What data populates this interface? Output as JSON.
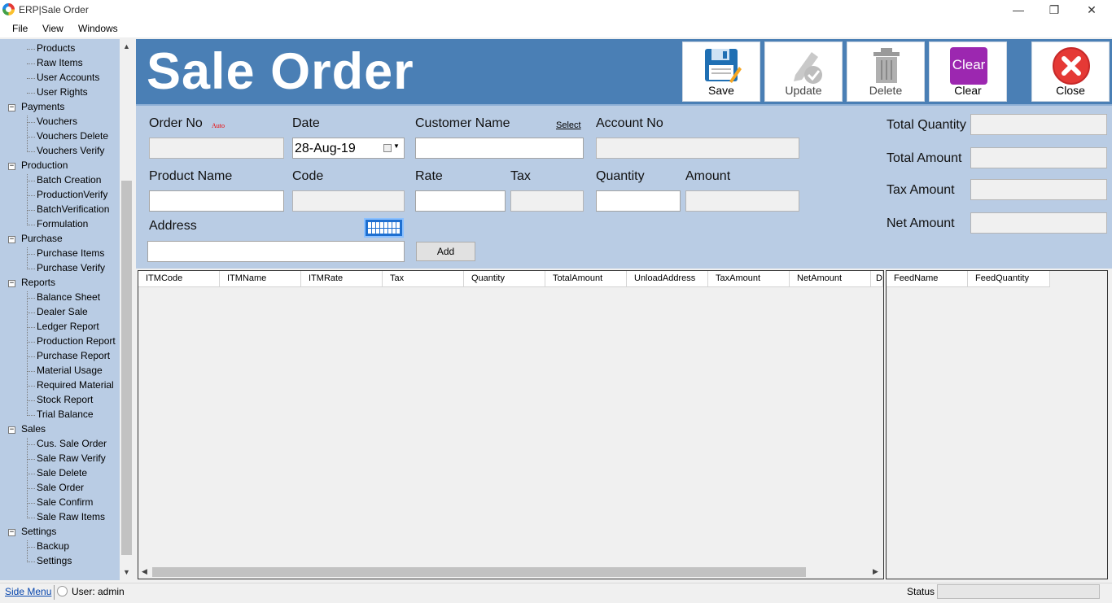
{
  "window": {
    "title": "ERP|Sale Order",
    "minimize": "—",
    "restore": "❐",
    "close": "✕"
  },
  "menu": [
    "File",
    "View",
    "Windows"
  ],
  "sidebar": {
    "leaves_top": [
      "Products",
      "Raw Items",
      "User Accounts",
      "User Rights"
    ],
    "groups": [
      {
        "label": "Payments",
        "items": [
          "Vouchers",
          "Vouchers Delete",
          "Vouchers Verify"
        ]
      },
      {
        "label": "Production",
        "items": [
          "Batch Creation",
          "ProductionVerify",
          "BatchVerification",
          "Formulation"
        ]
      },
      {
        "label": "Purchase",
        "items": [
          "Purchase Items",
          "Purchase Verify"
        ]
      },
      {
        "label": "Reports",
        "items": [
          "Balance Sheet",
          "Dealer Sale",
          "Ledger Report",
          "Production Report",
          "Purchase Report",
          "Material Usage",
          "Required Material",
          "Stock Report",
          "Trial Balance"
        ]
      },
      {
        "label": "Sales",
        "items": [
          "Cus. Sale Order",
          "Sale Raw Verify",
          "Sale Delete",
          "Sale Order",
          "Sale Confirm",
          "Sale Raw Items"
        ]
      },
      {
        "label": "Settings",
        "items": [
          "Backup",
          "Settings"
        ]
      }
    ]
  },
  "header": {
    "title": "Sale Order",
    "buttons": {
      "save": "Save",
      "update": "Update",
      "delete": "Delete",
      "clear": "Clear",
      "clear_icon_text": "Clear",
      "close": "Close"
    }
  },
  "form": {
    "order_no_label": "Order No",
    "auto_label": "Auto",
    "date_label": "Date",
    "date_value": "28-Aug-19",
    "customer_name_label": "Customer Name",
    "select_link": "Select",
    "account_no_label": "Account No",
    "product_name_label": "Product Name",
    "code_label": "Code",
    "rate_label": "Rate",
    "tax_label": "Tax",
    "quantity_label": "Quantity",
    "amount_label": "Amount",
    "address_label": "Address",
    "add_button": "Add",
    "total_quantity_label": "Total Quantity",
    "total_amount_label": "Total Amount",
    "tax_amount_label": "Tax Amount",
    "net_amount_label": "Net Amount"
  },
  "items_grid": {
    "columns": [
      "ITMCode",
      "ITMName",
      "ITMRate",
      "Tax",
      "Quantity",
      "TotalAmount",
      "UnloadAddress",
      "TaxAmount",
      "NetAmount",
      "D"
    ]
  },
  "feed_grid": {
    "columns": [
      "FeedName",
      "FeedQuantity"
    ]
  },
  "status": {
    "side_menu_link": "Side Menu",
    "user_label": "User:",
    "user_value": "admin",
    "status_label": "Status"
  }
}
